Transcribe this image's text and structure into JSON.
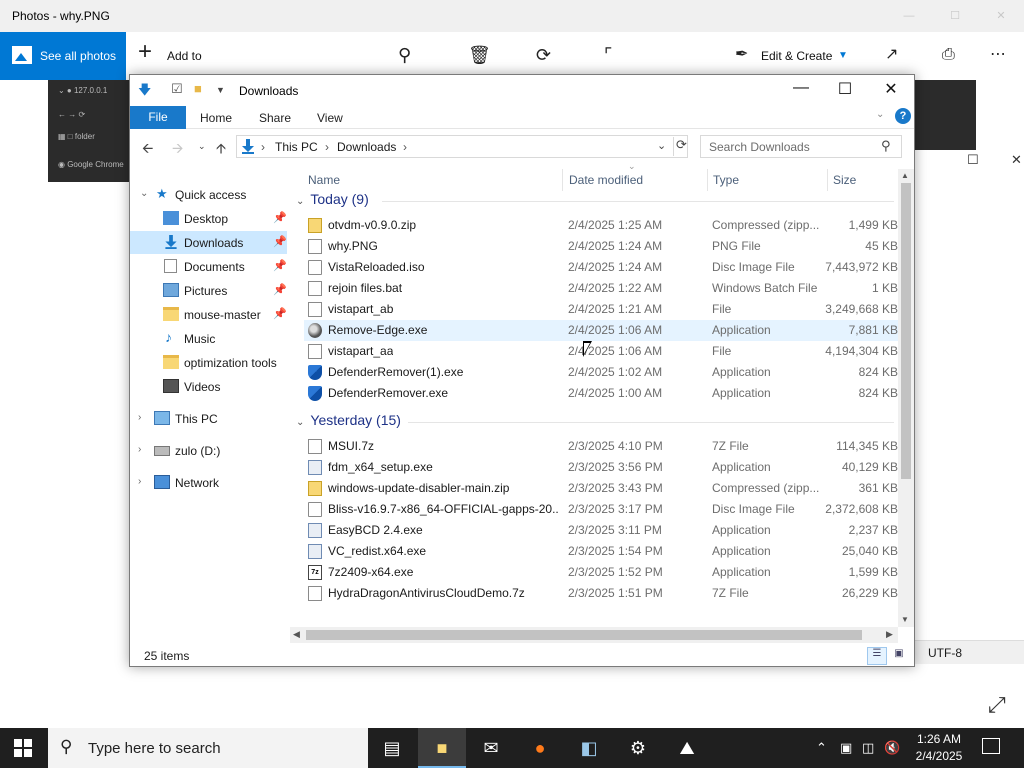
{
  "photos": {
    "title": "Photos - why.PNG",
    "see_all": "See all photos",
    "add_to": "Add to",
    "edit_create": "Edit & Create"
  },
  "chrome_bg": {
    "address": "127.0.0.1",
    "folder": "folder",
    "google": "Google Chrome"
  },
  "notepad_bg": {
    "encoding": "UTF-8"
  },
  "explorer": {
    "title": "Downloads",
    "ribbon_tabs": [
      "File",
      "Home",
      "Share",
      "View"
    ],
    "breadcrumb": [
      "This PC",
      "Downloads"
    ],
    "search_placeholder": "Search Downloads",
    "columns": [
      "Name",
      "Date modified",
      "Type",
      "Size"
    ],
    "nav": [
      {
        "label": "Quick access"
      },
      {
        "label": "Desktop"
      },
      {
        "label": "Downloads"
      },
      {
        "label": "Documents"
      },
      {
        "label": "Pictures"
      },
      {
        "label": "mouse-master"
      },
      {
        "label": "Music"
      },
      {
        "label": "optimization tools"
      },
      {
        "label": "Videos"
      },
      {
        "label": "This PC"
      },
      {
        "label": "zulo (D:)"
      },
      {
        "label": "Network"
      }
    ],
    "groups": [
      {
        "label": "Today (9)",
        "files": [
          {
            "name": "otvdm-v0.9.0.zip",
            "date": "2/4/2025 1:25 AM",
            "type": "Compressed (zipp...",
            "size": "1,499 KB",
            "icon": "zip"
          },
          {
            "name": "why.PNG",
            "date": "2/4/2025 1:24 AM",
            "type": "PNG File",
            "size": "45 KB",
            "icon": "png"
          },
          {
            "name": "VistaReloaded.iso",
            "date": "2/4/2025 1:24 AM",
            "type": "Disc Image File",
            "size": "7,443,972 KB",
            "icon": "iso"
          },
          {
            "name": "rejoin files.bat",
            "date": "2/4/2025 1:22 AM",
            "type": "Windows Batch File",
            "size": "1 KB",
            "icon": "file"
          },
          {
            "name": "vistapart_ab",
            "date": "2/4/2025 1:21 AM",
            "type": "File",
            "size": "3,249,668 KB",
            "icon": "file"
          },
          {
            "name": "Remove-Edge.exe",
            "date": "2/4/2025 1:06 AM",
            "type": "Application",
            "size": "7,881 KB",
            "icon": "exe-edge"
          },
          {
            "name": "vistapart_aa",
            "date": "2/4/2025 1:06 AM",
            "type": "File",
            "size": "4,194,304 KB",
            "icon": "file"
          },
          {
            "name": "DefenderRemover(1).exe",
            "date": "2/4/2025 1:02 AM",
            "type": "Application",
            "size": "824 KB",
            "icon": "shield"
          },
          {
            "name": "DefenderRemover.exe",
            "date": "2/4/2025 1:00 AM",
            "type": "Application",
            "size": "824 KB",
            "icon": "shield"
          }
        ]
      },
      {
        "label": "Yesterday (15)",
        "files": [
          {
            "name": "MSUI.7z",
            "date": "2/3/2025 4:10 PM",
            "type": "7Z File",
            "size": "114,345 KB",
            "icon": "file"
          },
          {
            "name": "fdm_x64_setup.exe",
            "date": "2/3/2025 3:56 PM",
            "type": "Application",
            "size": "40,129 KB",
            "icon": "exe"
          },
          {
            "name": "windows-update-disabler-main.zip",
            "date": "2/3/2025 3:43 PM",
            "type": "Compressed (zipp...",
            "size": "361 KB",
            "icon": "zip"
          },
          {
            "name": "Bliss-v16.9.7-x86_64-OFFICIAL-gapps-20...",
            "date": "2/3/2025 3:17 PM",
            "type": "Disc Image File",
            "size": "2,372,608 KB",
            "icon": "iso"
          },
          {
            "name": "EasyBCD 2.4.exe",
            "date": "2/3/2025 3:11 PM",
            "type": "Application",
            "size": "2,237 KB",
            "icon": "exe"
          },
          {
            "name": "VC_redist.x64.exe",
            "date": "2/3/2025 1:54 PM",
            "type": "Application",
            "size": "25,040 KB",
            "icon": "exe"
          },
          {
            "name": "7z2409-x64.exe",
            "date": "2/3/2025 1:52 PM",
            "type": "Application",
            "size": "1,599 KB",
            "icon": "sevenz"
          },
          {
            "name": "HydraDragonAntivirusCloudDemo.7z",
            "date": "2/3/2025 1:51 PM",
            "type": "7Z File",
            "size": "26,229 KB",
            "icon": "file"
          }
        ]
      }
    ],
    "status_count": "25 items"
  },
  "taskbar": {
    "search_placeholder": "Type here to search",
    "time": "1:26 AM",
    "date": "2/4/2025"
  }
}
